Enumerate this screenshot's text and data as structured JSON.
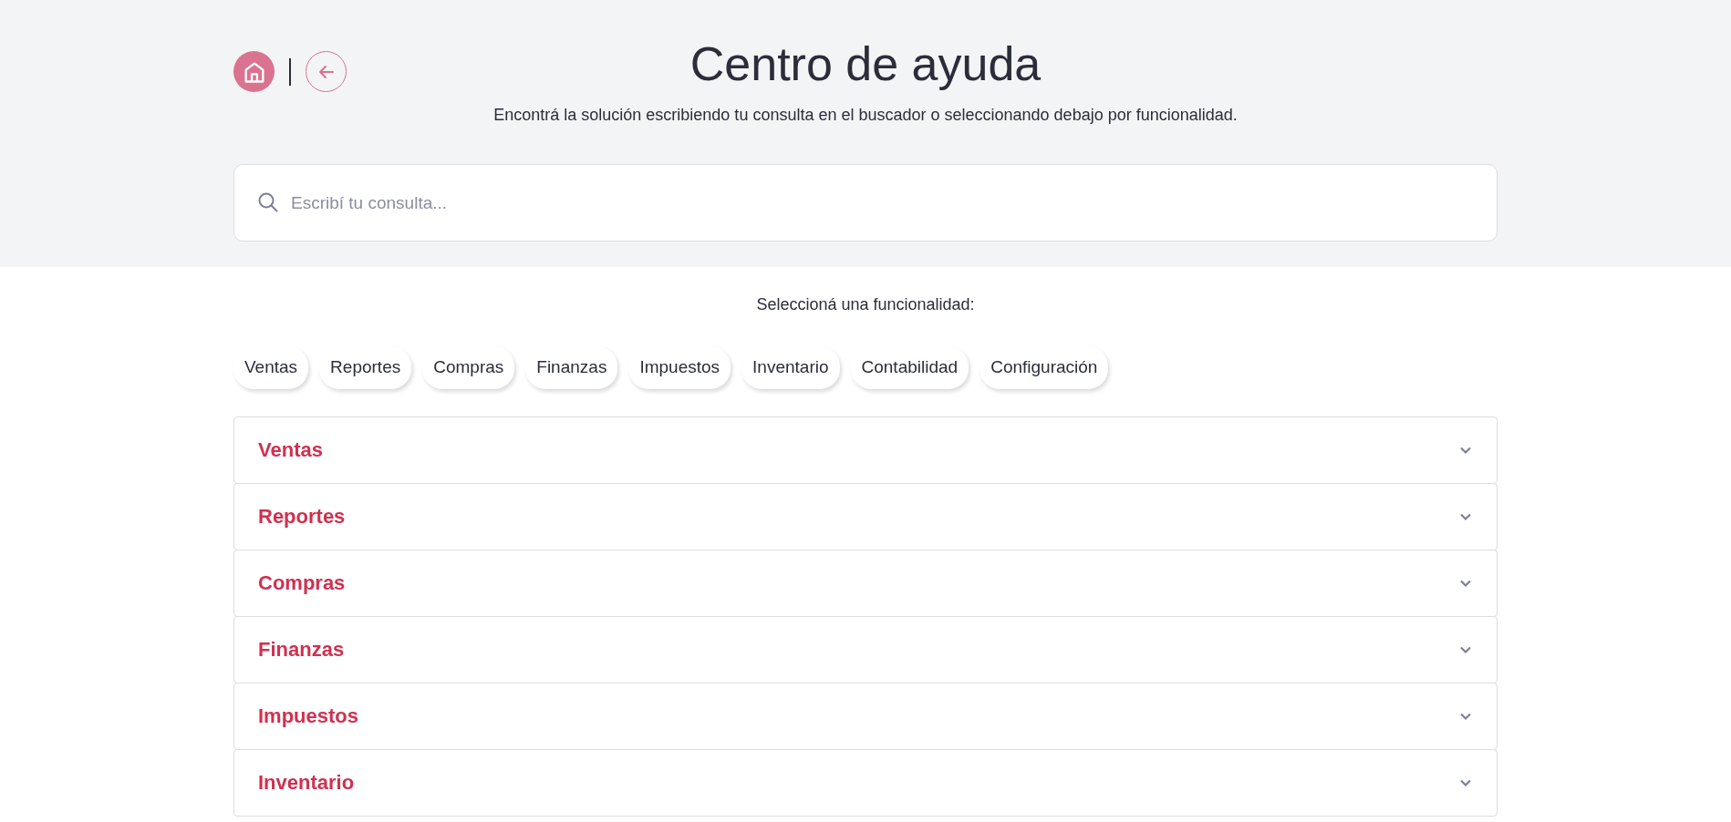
{
  "header": {
    "title": "Centro de ayuda",
    "subtitle": "Encontrá la solución escribiendo tu consulta en el buscador o seleccionando debajo por funcionalidad."
  },
  "search": {
    "placeholder": "Escribí tu consulta..."
  },
  "filter_label": "Seleccioná una funcionalidad:",
  "chips": [
    {
      "label": "Ventas",
      "selected": false
    },
    {
      "label": "Reportes",
      "selected": false
    },
    {
      "label": "Compras",
      "selected": false
    },
    {
      "label": "Finanzas",
      "selected": false
    },
    {
      "label": "Impuestos",
      "selected": false
    },
    {
      "label": "Inventario",
      "selected": false
    },
    {
      "label": "Contabilidad",
      "selected": false
    },
    {
      "label": "Configuración",
      "selected": false
    }
  ],
  "sections": [
    {
      "title": "Ventas",
      "expanded": false
    },
    {
      "title": "Reportes",
      "expanded": false
    },
    {
      "title": "Compras",
      "expanded": false
    },
    {
      "title": "Finanzas",
      "expanded": false
    },
    {
      "title": "Impuestos",
      "expanded": false
    },
    {
      "title": "Inventario",
      "expanded": false
    }
  ]
}
